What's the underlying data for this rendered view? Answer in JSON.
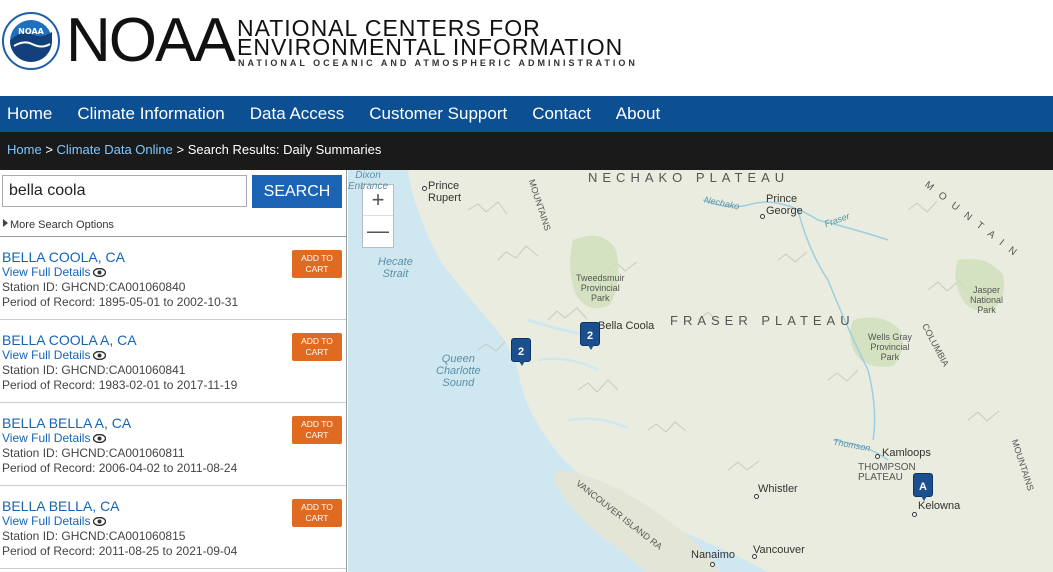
{
  "header": {
    "logo_word": "NOAA",
    "title_line1": "NATIONAL CENTERS FOR",
    "title_line2": "ENVIRONMENTAL INFORMATION",
    "title_line3": "NATIONAL OCEANIC AND ATMOSPHERIC ADMINISTRATION",
    "seal_text": "NOAA"
  },
  "nav": {
    "items": [
      "Home",
      "Climate Information",
      "Data Access",
      "Customer Support",
      "Contact",
      "About"
    ]
  },
  "breadcrumb": {
    "home": "Home",
    "sep1": ">",
    "cdo": "Climate Data Online",
    "sep2": ">",
    "current": "Search Results: Daily Summaries"
  },
  "search": {
    "value": "bella coola",
    "button": "SEARCH",
    "more_options": "More Search Options"
  },
  "results": [
    {
      "name": "BELLA COOLA, CA",
      "details": "View Full Details",
      "station_id": "Station ID: GHCND:CA001060840",
      "period": "Period of Record:  1895-05-01 to 2002-10-31",
      "cart": [
        "ADD TO",
        "CART"
      ]
    },
    {
      "name": "BELLA COOLA A, CA",
      "details": "View Full Details",
      "station_id": "Station ID: GHCND:CA001060841",
      "period": "Period of Record:  1983-02-01 to 2017-11-19",
      "cart": [
        "ADD TO",
        "CART"
      ]
    },
    {
      "name": "BELLA BELLA A, CA",
      "details": "View Full Details",
      "station_id": "Station ID: GHCND:CA001060811",
      "period": "Period of Record:  2006-04-02 to 2011-08-24",
      "cart": [
        "ADD TO",
        "CART"
      ]
    },
    {
      "name": "BELLA BELLA, CA",
      "details": "View Full Details",
      "station_id": "Station ID: GHCND:CA001060815",
      "period": "Period of Record:  2011-08-25 to 2021-09-04",
      "cart": [
        "ADD TO",
        "CART"
      ]
    }
  ],
  "map": {
    "zoom_in": "+",
    "zoom_out": "—",
    "cities": {
      "prince_rupert": "Prince\nRupert",
      "prince_george": "Prince\nGeorge",
      "bella_coola": "Bella Coola",
      "kamloops": "Kamloops",
      "whistler": "Whistler",
      "kelowna": "Kelowna",
      "nanaimo": "Nanaimo",
      "vancouver": "Vancouver"
    },
    "regions": {
      "nechako": "NECHAKO  PLATEAU",
      "fraser": "FRASER  PLATEAU",
      "thompson": "THOMPSON\nPLATEAU",
      "columbia": "COLUMBIA",
      "mountains": "MOUNTAINS",
      "coast_mtns": "MOUNTAINS",
      "vancouver_island": "VANCOUVER ISLAND RA",
      "mountain_right": "M O U N T A I N"
    },
    "water": {
      "hecate": "Hecate\nStrait",
      "queen_charlotte": "Queen\nCharlotte\nSound",
      "dixon": "Dixon\nEntrance",
      "nechako_river": "Nechako",
      "fraser_river": "Fraser",
      "thomson_river": "Thomson"
    },
    "parks": {
      "tweedsmuir": "Tweedsmuir\nProvincial\nPark",
      "wells_gray": "Wells Gray\nProvincial\nPark",
      "jasper": "Jasper\nNational\nPark"
    },
    "markers": [
      {
        "label": "2"
      },
      {
        "label": "2"
      },
      {
        "label": "A"
      }
    ]
  },
  "colors": {
    "nav_bg": "#0d4f93",
    "breadcrumb_bg": "#1a1a1a",
    "search_btn": "#1b64b3",
    "cart_btn": "#e06a1f",
    "link": "#1565b5",
    "water": "#cfe7f1",
    "land": "#e9ecdf",
    "marker": "#1b4f8d"
  }
}
